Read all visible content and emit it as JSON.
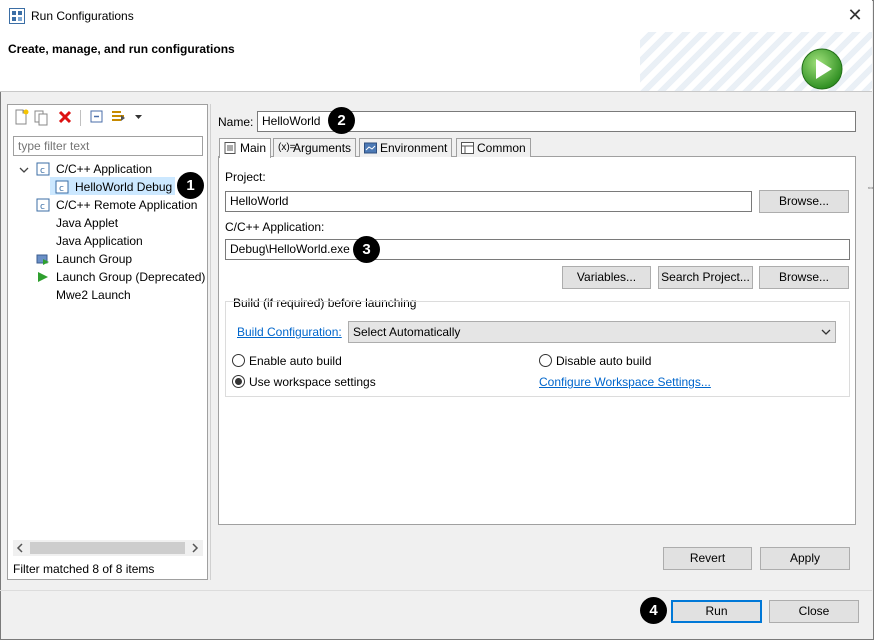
{
  "window": {
    "title": "Run Configurations",
    "close_glyph": "✕"
  },
  "header": {
    "title": "Create, manage, and run configurations"
  },
  "left": {
    "filter_placeholder": "type filter text",
    "tree": [
      {
        "label": "C/C++ Application",
        "expanded": true
      },
      {
        "label": "HelloWorld Debug",
        "selected": true
      },
      {
        "label": "C/C++ Remote Application"
      },
      {
        "label": "Java Applet"
      },
      {
        "label": "Java Application"
      },
      {
        "label": "Launch Group"
      },
      {
        "label": "Launch Group (Deprecated)"
      },
      {
        "label": "Mwe2 Launch"
      }
    ],
    "status": "Filter matched 8 of 8 items"
  },
  "form": {
    "name_label": "Name:",
    "name_value": "HelloWorld",
    "tabs": [
      "Main",
      "Arguments",
      "Environment",
      "Common"
    ],
    "project_label": "Project:",
    "project_value": "HelloWorld",
    "browse": "Browse...",
    "app_label": "C/C++ Application:",
    "app_value": "Debug\\HelloWorld.exe",
    "variables": "Variables...",
    "search_project": "Search Project...",
    "build_group_title": "Build (if required) before launching",
    "build_config_link": "Build Configuration:",
    "build_config_value": "Select Automatically",
    "enable_auto": "Enable auto build",
    "disable_auto": "Disable auto build",
    "use_workspace": "Use workspace settings",
    "configure_ws": "Configure Workspace Settings...",
    "revert": "Revert",
    "apply": "Apply"
  },
  "footer": {
    "run": "Run",
    "close": "Close"
  },
  "badges": [
    "1",
    "2",
    "3",
    "4"
  ],
  "colors": {
    "accent": "#0078d7",
    "selection": "#cce8ff",
    "link": "#0066cc",
    "run_green": "#3aa435"
  }
}
